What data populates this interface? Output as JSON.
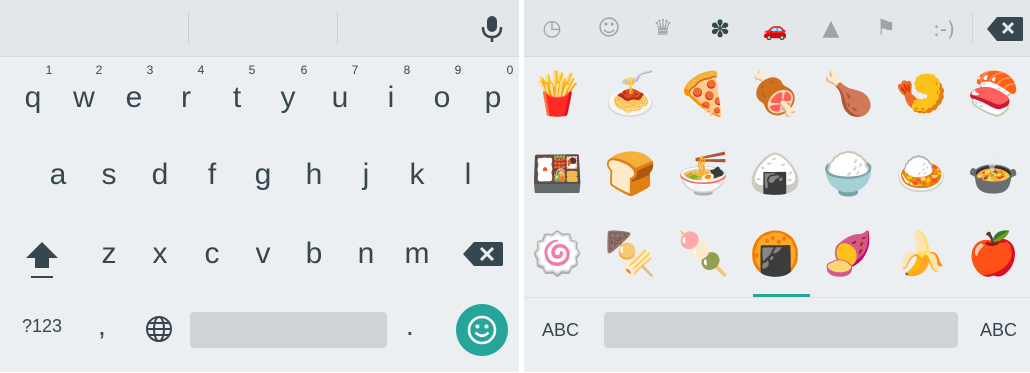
{
  "keyboard": {
    "suggestions": [
      "",
      "",
      ""
    ],
    "row1": [
      {
        "letter": "q",
        "hint": "1"
      },
      {
        "letter": "w",
        "hint": "2"
      },
      {
        "letter": "e",
        "hint": "3"
      },
      {
        "letter": "r",
        "hint": "4"
      },
      {
        "letter": "t",
        "hint": "5"
      },
      {
        "letter": "y",
        "hint": "6"
      },
      {
        "letter": "u",
        "hint": "7"
      },
      {
        "letter": "i",
        "hint": "8"
      },
      {
        "letter": "o",
        "hint": "9"
      },
      {
        "letter": "p",
        "hint": "0"
      }
    ],
    "row2": [
      "a",
      "s",
      "d",
      "f",
      "g",
      "h",
      "j",
      "k",
      "l"
    ],
    "row3": [
      "z",
      "x",
      "c",
      "v",
      "b",
      "n",
      "m"
    ],
    "bottom": {
      "symbols_label": "?123",
      "comma": ",",
      "period": "."
    },
    "icons": {
      "mic": "microphone-icon",
      "shift": "shift-arrow-icon",
      "backspace": "backspace-icon",
      "globe": "globe-icon",
      "emoji": "smiley-face-icon"
    },
    "colors": {
      "accent": "#26a69a",
      "key_text": "#37474f",
      "background": "#eceff1"
    }
  },
  "emoji_panel": {
    "categories": [
      {
        "name": "recent-clock-icon",
        "glyph": "◷"
      },
      {
        "name": "smileys-icon",
        "glyph": "☺"
      },
      {
        "name": "crown-objects-icon",
        "glyph": "♛"
      },
      {
        "name": "flower-nature-icon",
        "glyph": "✽"
      },
      {
        "name": "car-travel-icon",
        "glyph": "🚗"
      },
      {
        "name": "triangle-symbols-icon",
        "glyph": "▲"
      },
      {
        "name": "flag-icon",
        "glyph": "⚑"
      },
      {
        "name": "emoticons-icon",
        "glyph": ":-)"
      }
    ],
    "active_category": "flower-nature-icon",
    "emojis": [
      [
        "🍟",
        "🍝",
        "🍕",
        "🍖",
        "🍗",
        "🍤",
        "🍣"
      ],
      [
        "🍱",
        "🍞",
        "🍜",
        "🍙",
        "🍚",
        "🍛",
        "🍲"
      ],
      [
        "🍥",
        "🍢",
        "🍡",
        "🍘",
        "🍠",
        "🍌",
        "🍎"
      ]
    ],
    "bottom": {
      "left_label": "ABC",
      "right_label": "ABC"
    }
  }
}
